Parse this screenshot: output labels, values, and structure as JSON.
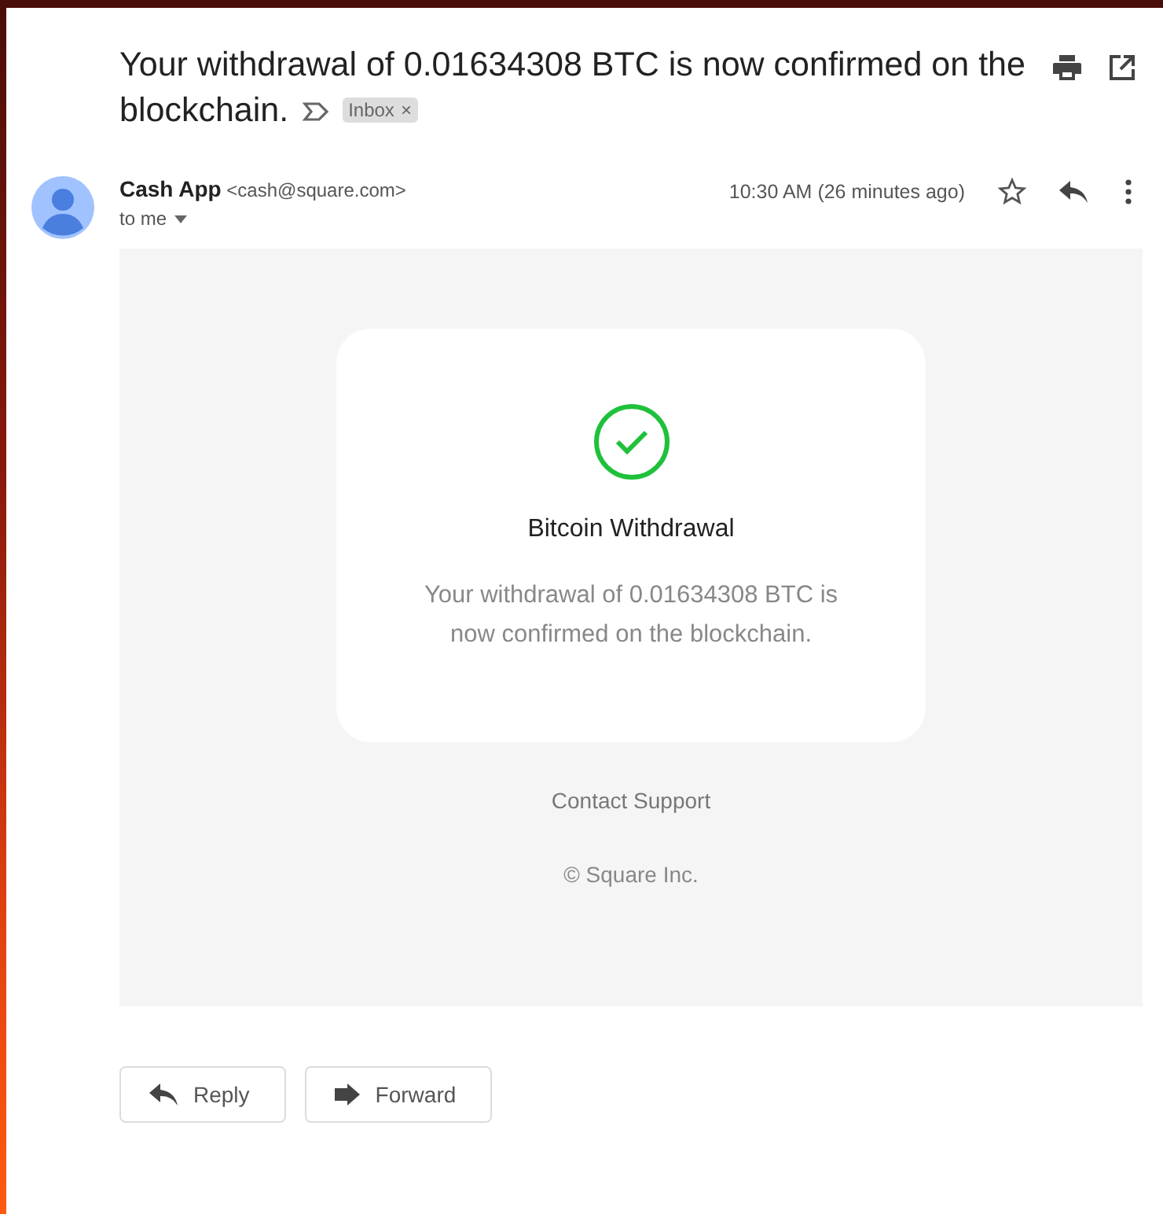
{
  "subject": {
    "text": "Your withdrawal of 0.01634308 BTC is now confirmed on the blockchain.",
    "label": {
      "text": "Inbox",
      "remove": "×"
    }
  },
  "sender": {
    "name": "Cash App",
    "email": "<cash@square.com>",
    "recipient": "to me",
    "time": "10:30 AM (26 minutes ago)"
  },
  "card": {
    "title": "Bitcoin Withdrawal",
    "body": "Your withdrawal of 0.01634308 BTC is now confirmed on the blockchain."
  },
  "footer": {
    "link": "Contact Support",
    "copyright": "© Square Inc."
  },
  "buttons": [
    {
      "kind": "reply",
      "label": "Reply"
    },
    {
      "kind": "forward",
      "label": "Forward"
    }
  ]
}
